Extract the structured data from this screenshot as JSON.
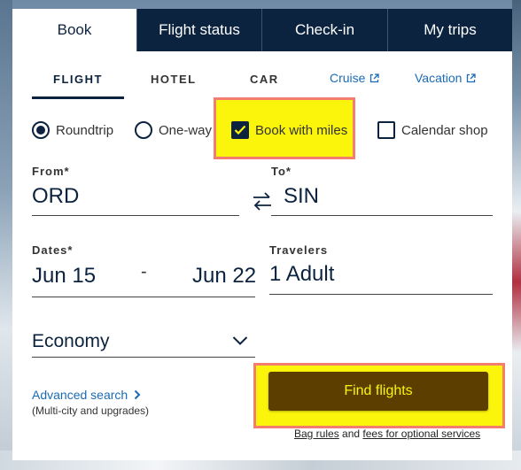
{
  "tabs": [
    {
      "label": "Book",
      "active": true
    },
    {
      "label": "Flight status",
      "active": false
    },
    {
      "label": "Check-in",
      "active": false
    },
    {
      "label": "My trips",
      "active": false
    }
  ],
  "subtabs": {
    "flight": "FLIGHT",
    "hotel": "HOTEL",
    "car": "CAR",
    "cruise": "Cruise",
    "vacation": "Vacation"
  },
  "trip_type": {
    "roundtrip": "Roundtrip",
    "oneway": "One-way",
    "selected": "Roundtrip"
  },
  "options": {
    "book_with_miles": {
      "label": "Book with miles",
      "checked": true
    },
    "calendar_shop": {
      "label": "Calendar shop",
      "checked": false
    }
  },
  "from": {
    "label": "From*",
    "value": "ORD"
  },
  "to": {
    "label": "To*",
    "value": "SIN"
  },
  "dates": {
    "label": "Dates*",
    "depart": "Jun 15",
    "separator": "-",
    "return": "Jun 22"
  },
  "travelers": {
    "label": "Travelers",
    "value": "1 Adult"
  },
  "cabin": {
    "value": "Economy"
  },
  "advanced": {
    "label": "Advanced search",
    "sub": "(Multi-city and upgrades)"
  },
  "find_button": "Find flights",
  "footer": {
    "bag_rules": "Bag rules",
    "and": "and",
    "fees": "fees for optional services"
  },
  "colors": {
    "navy": "#0c2340",
    "link": "#1a6bb5",
    "highlight": "#fbf40b",
    "highlight_border": "#f37d6e",
    "button": "#5c3f00"
  }
}
